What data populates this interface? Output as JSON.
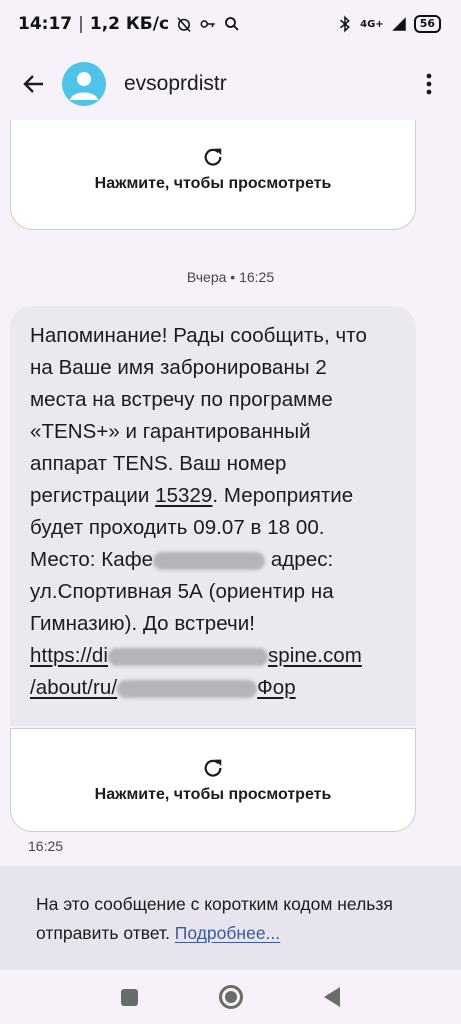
{
  "status_bar": {
    "time": "14:17",
    "separator": "|",
    "speed": "1,2 КБ/с",
    "network": "4G+",
    "battery": "56"
  },
  "app_bar": {
    "title": "evsoprdistr"
  },
  "conversation": {
    "attachment_label": "Нажмите, чтобы просмотреть",
    "date_separator": "Вчера • 16:25",
    "message": {
      "l1": "Напоминание! Рады сообщить, что",
      "l2": "на Ваше имя забронированы 2",
      "l3": "места на встречу по программе",
      "l4": "«TENS+» и гарантированный",
      "l5": "аппарат TENS. Ваш номер",
      "l6_pre": "регистрации ",
      "reg_number": "15329",
      "l6_post": ". Мероприятие",
      "l7": "будет проходить 09.07 в 18 00.",
      "l8_pre": "Место: Кафе",
      "l8_post": " адрес:",
      "l9": "ул.Спортивная 5А (ориентир на",
      "l10": "Гимназию). До встречи!",
      "link1_pre": "https://di",
      "link1_post": "spine.com",
      "link2_pre": "/about/ru/",
      "link2_post": "Фор"
    },
    "attachment_label_2": "Нажмите, чтобы просмотреть",
    "timestamp": "16:25"
  },
  "info": {
    "text": "На это сообщение с коротким кодом нельзя отправить ответ. ",
    "link": "Подробнее..."
  },
  "colors": {
    "background": "#f7f2fa",
    "bubble": "#ece8ef",
    "avatar": "#4fc3e8",
    "link": "#3d5a98"
  }
}
